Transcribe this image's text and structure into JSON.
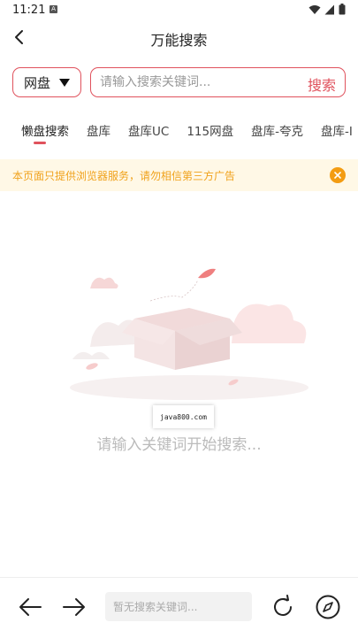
{
  "status_bar": {
    "time": "11:21",
    "notification_icon": "A"
  },
  "header": {
    "title": "万能搜索"
  },
  "search": {
    "type_value": "网盘",
    "placeholder": "请输入搜索关键词...",
    "button_label": "搜索"
  },
  "tabs": [
    {
      "label": "懒盘搜索",
      "active": true
    },
    {
      "label": "盘库",
      "active": false
    },
    {
      "label": "盘库UC",
      "active": false
    },
    {
      "label": "115网盘",
      "active": false
    },
    {
      "label": "盘库-夸克",
      "active": false
    },
    {
      "label": "盘库-I",
      "active": false
    }
  ],
  "notice": {
    "text": "本页面只提供浏览器服务，请勿相信第三方广告"
  },
  "empty_state": {
    "watermark": "java800.com",
    "message": "请输入关键词开始搜索..."
  },
  "bottom_bar": {
    "search_placeholder": "暂无搜索关键词..."
  },
  "colors": {
    "accent": "#e0525d",
    "notice_text": "#f0a21c",
    "notice_bg": "#fff8e6"
  }
}
